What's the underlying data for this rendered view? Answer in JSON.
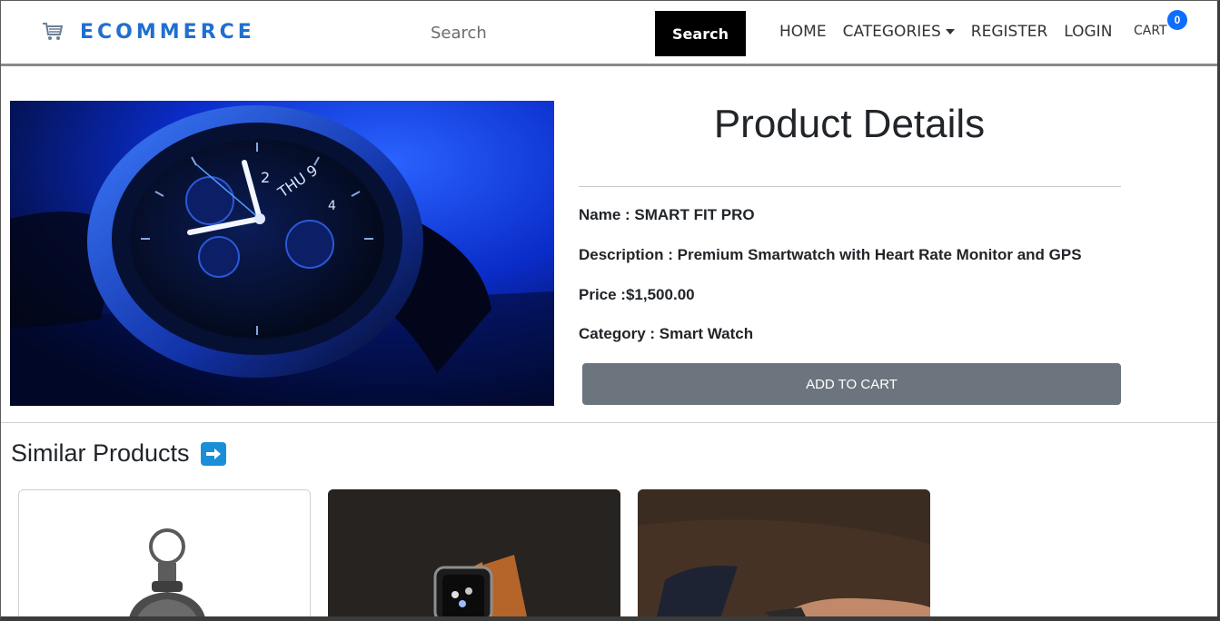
{
  "navbar": {
    "brand": "ECOMMERCE",
    "search_placeholder": "Search",
    "search_button": "Search",
    "links": {
      "home": "HOME",
      "categories": "CATEGORIES",
      "register": "REGISTER",
      "login": "LOGIN"
    },
    "cart_label": "CART",
    "cart_count": "0"
  },
  "product": {
    "heading": "Product Details",
    "name_line": "Name : SMART FIT PRO",
    "description_line": "Description : Premium Smartwatch with Heart Rate Monitor and GPS",
    "price_line": "Price :$1,500.00",
    "category_line": "Category : Smart Watch",
    "add_to_cart": "ADD TO CART",
    "image_icon": "smartwatch-photo"
  },
  "similar": {
    "title": "Similar Products",
    "arrow_icon": "right-arrow-icon",
    "cards": [
      {
        "image_icon": "pocket-watch-photo"
      },
      {
        "image_icon": "smartwatch-orange-strap-photo"
      },
      {
        "image_icon": "wrist-watch-photo"
      }
    ]
  },
  "colors": {
    "brand": "#1f6fd1",
    "badge": "#0d6efd",
    "button_gray": "#6c757d",
    "search_button": "#000000"
  }
}
